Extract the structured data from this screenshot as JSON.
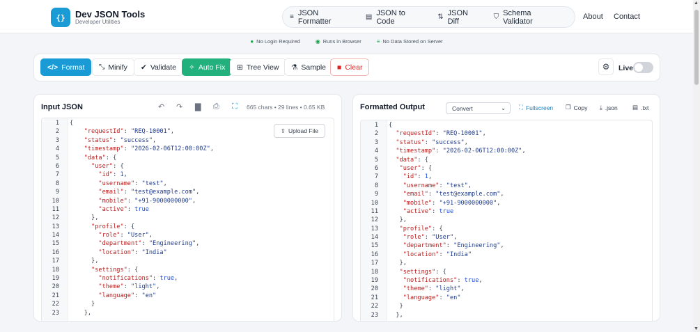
{
  "brand": {
    "logo_text": "{}",
    "title": "Dev JSON Tools",
    "subtitle": "Developer Utilities"
  },
  "nav": {
    "items": [
      {
        "label": "JSON Formatter",
        "icon": "align-left-icon"
      },
      {
        "label": "JSON to Code",
        "icon": "file-code-icon"
      },
      {
        "label": "JSON Diff",
        "icon": "diff-icon"
      },
      {
        "label": "Schema Validator",
        "icon": "shield-icon"
      }
    ],
    "about": "About",
    "contact": "Contact"
  },
  "badges": [
    "No Login Required",
    "Runs in Browser",
    "No Data Stored on Server"
  ],
  "toolbar": {
    "format": "Format",
    "minify": "Minify",
    "validate": "Validate",
    "autofix": "Auto Fix",
    "treeview": "Tree View",
    "sample": "Sample",
    "clear": "Clear",
    "live": "Live"
  },
  "input": {
    "title": "Input JSON",
    "stats": "665 chars • 29 lines • 0.65 KB",
    "upload": "Upload File"
  },
  "output": {
    "title": "Formatted Output",
    "select_value": "Convert",
    "fullscreen": "Fullscreen",
    "copy": "Copy",
    "json": ".json",
    "txt": ".txt"
  },
  "code_lines": [
    [
      {
        "t": "{",
        "c": "p"
      }
    ],
    [
      {
        "t": "    ",
        "c": "p"
      },
      {
        "t": "\"requestId\"",
        "c": "k"
      },
      {
        "t": ": ",
        "c": "p"
      },
      {
        "t": "\"REQ-10001\"",
        "c": "s"
      },
      {
        "t": ",",
        "c": "p"
      }
    ],
    [
      {
        "t": "    ",
        "c": "p"
      },
      {
        "t": "\"status\"",
        "c": "k"
      },
      {
        "t": ": ",
        "c": "p"
      },
      {
        "t": "\"success\"",
        "c": "s"
      },
      {
        "t": ",",
        "c": "p"
      }
    ],
    [
      {
        "t": "    ",
        "c": "p"
      },
      {
        "t": "\"timestamp\"",
        "c": "k"
      },
      {
        "t": ": ",
        "c": "p"
      },
      {
        "t": "\"2026-02-06T12:00:00Z\"",
        "c": "s"
      },
      {
        "t": ",",
        "c": "p"
      }
    ],
    [
      {
        "t": "    ",
        "c": "p"
      },
      {
        "t": "\"data\"",
        "c": "k"
      },
      {
        "t": ": {",
        "c": "p"
      }
    ],
    [
      {
        "t": "      ",
        "c": "p"
      },
      {
        "t": "\"user\"",
        "c": "k"
      },
      {
        "t": ": {",
        "c": "p"
      }
    ],
    [
      {
        "t": "        ",
        "c": "p"
      },
      {
        "t": "\"id\"",
        "c": "k"
      },
      {
        "t": ": ",
        "c": "p"
      },
      {
        "t": "1",
        "c": "n"
      },
      {
        "t": ",",
        "c": "p"
      }
    ],
    [
      {
        "t": "        ",
        "c": "p"
      },
      {
        "t": "\"username\"",
        "c": "k"
      },
      {
        "t": ": ",
        "c": "p"
      },
      {
        "t": "\"test\"",
        "c": "s"
      },
      {
        "t": ",",
        "c": "p"
      }
    ],
    [
      {
        "t": "        ",
        "c": "p"
      },
      {
        "t": "\"email\"",
        "c": "k"
      },
      {
        "t": ": ",
        "c": "p"
      },
      {
        "t": "\"test@example.com\"",
        "c": "s"
      },
      {
        "t": ",",
        "c": "p"
      }
    ],
    [
      {
        "t": "        ",
        "c": "p"
      },
      {
        "t": "\"mobile\"",
        "c": "k"
      },
      {
        "t": ": ",
        "c": "p"
      },
      {
        "t": "\"+91-9000000000\"",
        "c": "s"
      },
      {
        "t": ",",
        "c": "p"
      }
    ],
    [
      {
        "t": "        ",
        "c": "p"
      },
      {
        "t": "\"active\"",
        "c": "k"
      },
      {
        "t": ": ",
        "c": "p"
      },
      {
        "t": "true",
        "c": "b"
      }
    ],
    [
      {
        "t": "      },",
        "c": "p"
      }
    ],
    [
      {
        "t": "      ",
        "c": "p"
      },
      {
        "t": "\"profile\"",
        "c": "k"
      },
      {
        "t": ": {",
        "c": "p"
      }
    ],
    [
      {
        "t": "        ",
        "c": "p"
      },
      {
        "t": "\"role\"",
        "c": "k"
      },
      {
        "t": ": ",
        "c": "p"
      },
      {
        "t": "\"User\"",
        "c": "s"
      },
      {
        "t": ",",
        "c": "p"
      }
    ],
    [
      {
        "t": "        ",
        "c": "p"
      },
      {
        "t": "\"department\"",
        "c": "k"
      },
      {
        "t": ": ",
        "c": "p"
      },
      {
        "t": "\"Engineering\"",
        "c": "s"
      },
      {
        "t": ",",
        "c": "p"
      }
    ],
    [
      {
        "t": "        ",
        "c": "p"
      },
      {
        "t": "\"location\"",
        "c": "k"
      },
      {
        "t": ": ",
        "c": "p"
      },
      {
        "t": "\"India\"",
        "c": "s"
      }
    ],
    [
      {
        "t": "      },",
        "c": "p"
      }
    ],
    [
      {
        "t": "      ",
        "c": "p"
      },
      {
        "t": "\"settings\"",
        "c": "k"
      },
      {
        "t": ": {",
        "c": "p"
      }
    ],
    [
      {
        "t": "        ",
        "c": "p"
      },
      {
        "t": "\"notifications\"",
        "c": "k"
      },
      {
        "t": ": ",
        "c": "p"
      },
      {
        "t": "true",
        "c": "b"
      },
      {
        "t": ",",
        "c": "p"
      }
    ],
    [
      {
        "t": "        ",
        "c": "p"
      },
      {
        "t": "\"theme\"",
        "c": "k"
      },
      {
        "t": ": ",
        "c": "p"
      },
      {
        "t": "\"light\"",
        "c": "s"
      },
      {
        "t": ",",
        "c": "p"
      }
    ],
    [
      {
        "t": "        ",
        "c": "p"
      },
      {
        "t": "\"language\"",
        "c": "k"
      },
      {
        "t": ": ",
        "c": "p"
      },
      {
        "t": "\"en\"",
        "c": "s"
      }
    ],
    [
      {
        "t": "      }",
        "c": "p"
      }
    ],
    [
      {
        "t": "    },",
        "c": "p"
      }
    ]
  ],
  "colors": {
    "accent": "#1a9bd6",
    "success": "#22b07d",
    "danger": "#dc2626",
    "key": "#b91c1c",
    "string": "#1e3a8a"
  }
}
